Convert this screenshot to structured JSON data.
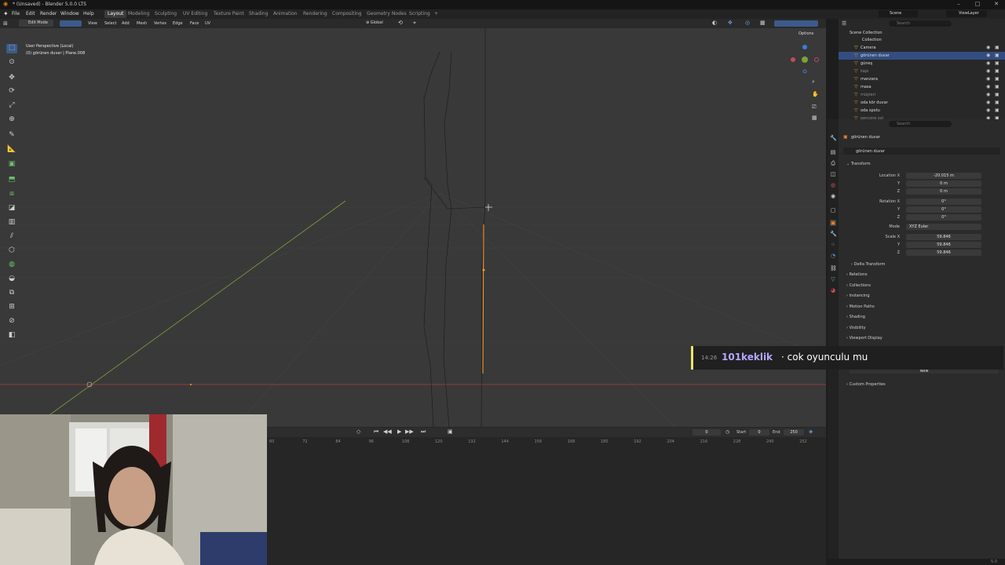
{
  "window": {
    "title": "* (Unsaved) - Blender 5.0.0 LTS"
  },
  "menu": {
    "items": [
      "File",
      "Edit",
      "Render",
      "Window",
      "Help"
    ]
  },
  "workspaces": [
    {
      "label": "Layout",
      "active": true
    },
    {
      "label": "Modeling",
      "active": false
    },
    {
      "label": "Sculpting",
      "active": false
    },
    {
      "label": "UV Editing",
      "active": false
    },
    {
      "label": "Texture Paint",
      "active": false
    },
    {
      "label": "Shading",
      "active": false
    },
    {
      "label": "Animation",
      "active": false
    },
    {
      "label": "Rendering",
      "active": false
    },
    {
      "label": "Compositing",
      "active": false
    },
    {
      "label": "Geometry Nodes",
      "active": false
    },
    {
      "label": "Scripting",
      "active": false
    }
  ],
  "topright": {
    "scene": "Scene",
    "viewlayer": "ViewLayer"
  },
  "viewport_header": {
    "mode": "Edit Mode",
    "menus": [
      "View",
      "Select",
      "Add",
      "Mesh",
      "Vertex",
      "Edge",
      "Face",
      "UV"
    ],
    "orientation": "Global",
    "options": "Options"
  },
  "viewport": {
    "perspective": "User Perspective (Local)",
    "object_info": "(0) görünen duvar | Plane.008"
  },
  "outliner": {
    "root": "Scene Collection",
    "collection": "Collection",
    "search_placeholder": "Search",
    "items": [
      {
        "label": "Camera",
        "selected": false,
        "dim": false
      },
      {
        "label": "görünen duvar",
        "selected": true,
        "dim": false
      },
      {
        "label": "güneş",
        "selected": false,
        "dim": false
      },
      {
        "label": "kapı",
        "selected": false,
        "dim": true
      },
      {
        "label": "manzara",
        "selected": false,
        "dim": false
      },
      {
        "label": "masa",
        "selected": false,
        "dim": false
      },
      {
        "label": "müşteri",
        "selected": false,
        "dim": true
      },
      {
        "label": "oda kör duvar",
        "selected": false,
        "dim": false
      },
      {
        "label": "oda spotu",
        "selected": false,
        "dim": false
      },
      {
        "label": "pencere sol",
        "selected": false,
        "dim": true
      }
    ]
  },
  "properties": {
    "search_placeholder": "Search",
    "object_name": "görünen duvar",
    "object_name_field": "görünen duvar",
    "transform_label": "Transform",
    "location": {
      "label_x": "Location X",
      "label_y": "Y",
      "label_z": "Z",
      "x": "-20.015 m",
      "y": "0 m",
      "z": "0 m"
    },
    "rotation": {
      "label_x": "Rotation X",
      "label_y": "Y",
      "label_z": "Z",
      "x": "0°",
      "y": "0°",
      "z": "0°"
    },
    "mode": {
      "label": "Mode",
      "value": "XYZ Euler"
    },
    "scale": {
      "label_x": "Scale X",
      "label_y": "Y",
      "label_z": "Z",
      "x": "59.846",
      "y": "59.846",
      "z": "59.846"
    },
    "subsections": [
      "Delta Transform"
    ],
    "sections": [
      "Relations",
      "Collections",
      "Instancing",
      "Motion Paths",
      "Shading",
      "Visibility",
      "Viewport Display"
    ],
    "custom": "Custom Properties",
    "new_button": "New"
  },
  "timeline": {
    "current_frame": "0",
    "start_label": "Start",
    "start": "0",
    "end_label": "End",
    "end": "250",
    "frame_numbers": [
      "60",
      "72",
      "84",
      "96",
      "108",
      "120",
      "132",
      "144",
      "156",
      "168",
      "180",
      "192",
      "204",
      "216",
      "228",
      "240",
      "252"
    ]
  },
  "chat": {
    "time": "14:26",
    "user": "101keklik",
    "message": "· cok oyunculu mu"
  },
  "statusbar": {
    "version": "5.0"
  },
  "colors": {
    "selection": "#334d80",
    "x_axis": "#b8363d",
    "y_axis": "#7aa23b",
    "edge_selected": "#ff9a2e",
    "chat_user": "#b3a8ff"
  }
}
